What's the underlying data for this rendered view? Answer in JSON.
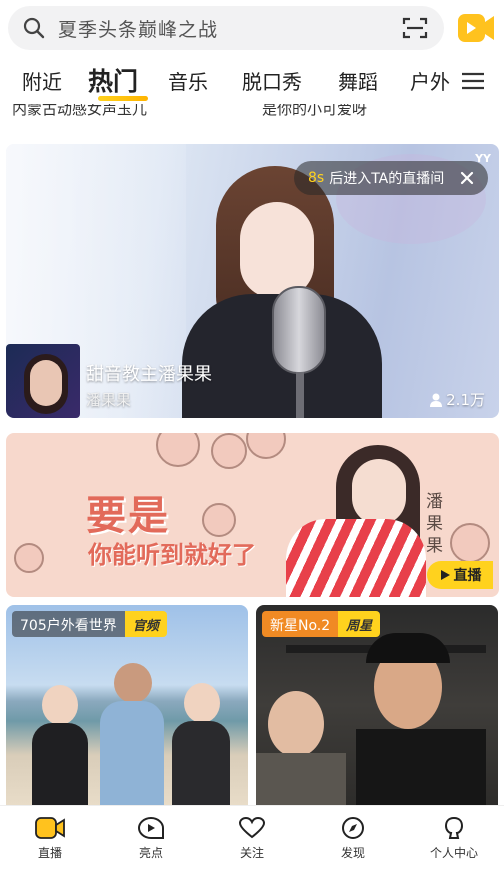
{
  "search": {
    "query": "夏季头条巅峰之战",
    "icon": "search-icon",
    "scan_icon": "scan-icon"
  },
  "header": {
    "camera_icon": "video-camera-icon",
    "accent": "#ffc21e"
  },
  "tabs": [
    {
      "label": "附近",
      "active": false
    },
    {
      "label": "热门",
      "active": true
    },
    {
      "label": "音乐",
      "active": false
    },
    {
      "label": "脱口秀",
      "active": false
    },
    {
      "label": "舞蹈",
      "active": false
    },
    {
      "label": "户外",
      "active": false
    }
  ],
  "prev_row": {
    "left_title": "内蒙古动感女声玉儿",
    "right_title": "是你的小可爱呀"
  },
  "live_card": {
    "corner_logo": "YY",
    "countdown": "8s",
    "enter_text": "后进入TA的直播间",
    "title": "甜音教主潘果果",
    "host": "潘果果",
    "viewers": "2.1万"
  },
  "banner": {
    "headline": "要是",
    "subline": "你能听到就好了",
    "vertical_text": "潘果果",
    "live_chip": "直播"
  },
  "cards": [
    {
      "name": "705户外看世界",
      "badge": "官频"
    },
    {
      "name": "新星No.2",
      "badge": "周星"
    }
  ],
  "bottom_nav": [
    {
      "label": "直播",
      "icon": "live-camera-icon",
      "active": true
    },
    {
      "label": "亮点",
      "icon": "highlight-icon",
      "active": false
    },
    {
      "label": "关注",
      "icon": "heart-icon",
      "active": false
    },
    {
      "label": "发现",
      "icon": "compass-icon",
      "active": false
    },
    {
      "label": "个人中心",
      "icon": "profile-icon",
      "active": false
    }
  ]
}
